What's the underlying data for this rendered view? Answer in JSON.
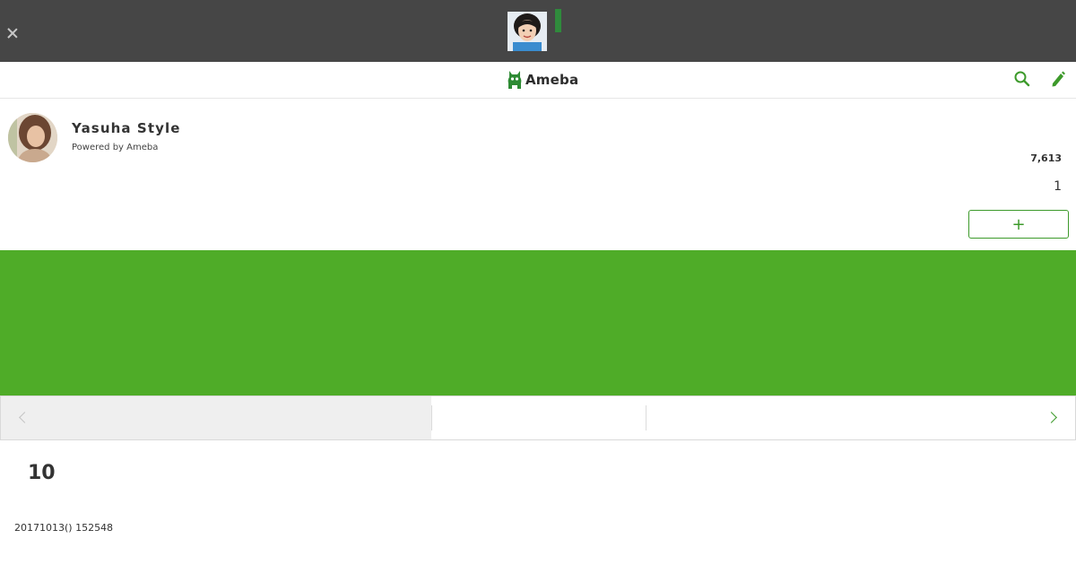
{
  "header": {
    "logo_text": "Ameba"
  },
  "blog": {
    "title": "Yasuha Style",
    "powered_by": "Powered by Ameba",
    "reader_count": "7,613",
    "count_one": "1",
    "follow_label": "+"
  },
  "article": {
    "heading": "10",
    "date": "20171013() 152548"
  },
  "colors": {
    "banner_bg": "#464646",
    "brand_green": "#4fac28",
    "accent_green": "#3d9a2b"
  },
  "icons": {
    "close": "close-icon",
    "search": "search-icon",
    "edit": "pencil-icon",
    "prev": "chevron-left-icon",
    "next": "chevron-right-icon"
  }
}
